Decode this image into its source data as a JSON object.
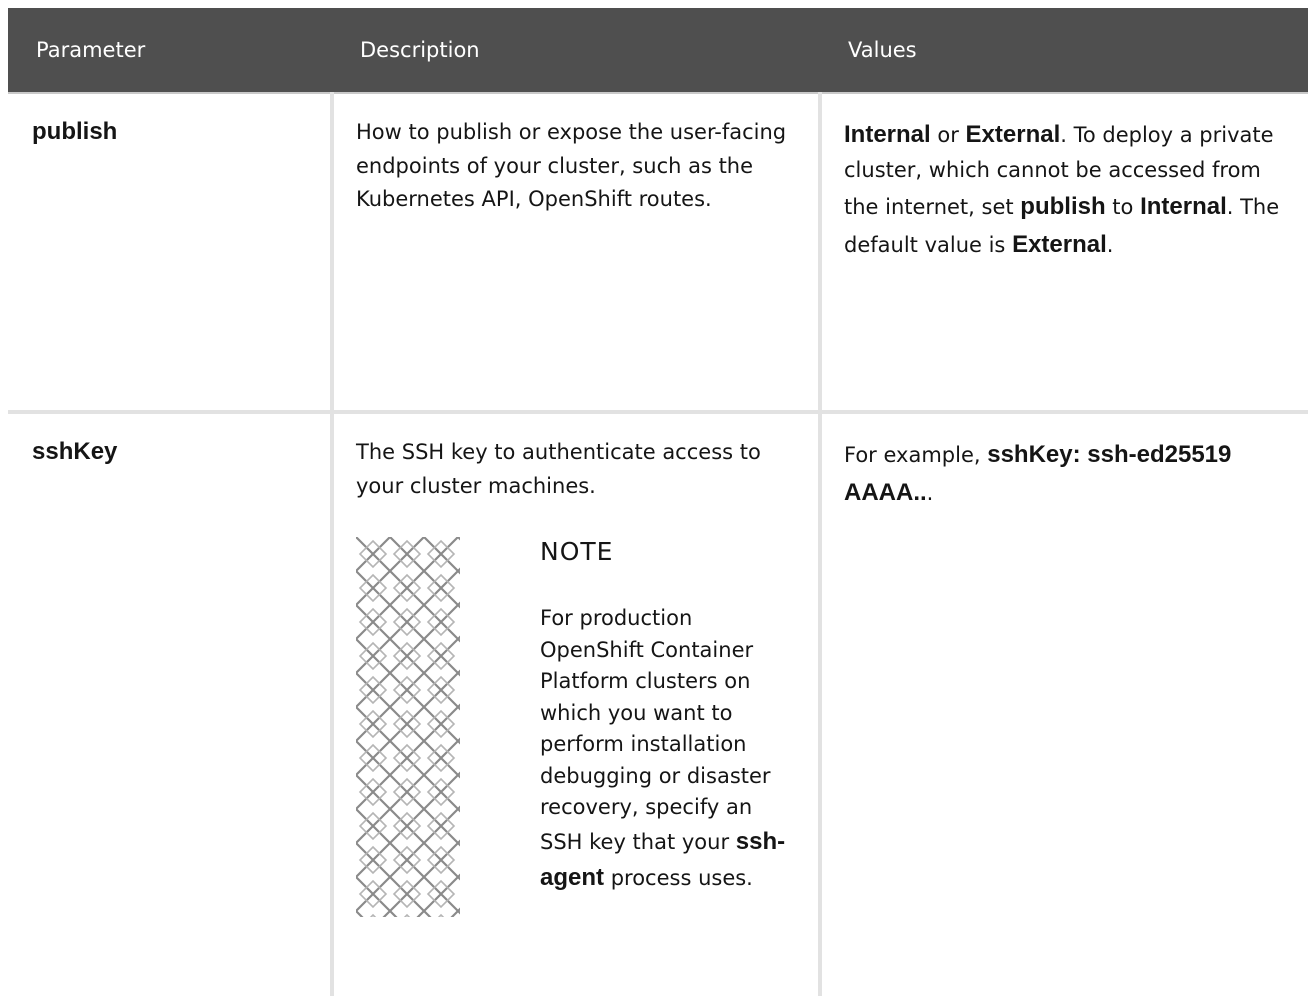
{
  "header": {
    "col_parameter": "Parameter",
    "col_description": "Description",
    "col_values": "Values"
  },
  "rows": [
    {
      "parameter": "publish",
      "description": "How to publish or expose the user-facing endpoints of your cluster, such as the Kubernetes API, OpenShift routes.",
      "values": {
        "v1": "Internal",
        "t1": " or ",
        "v2": "External",
        "t2": ". To deploy a private cluster, which cannot be accessed from the internet, set ",
        "v3": "publish",
        "t3": " to ",
        "v4": "Internal",
        "t4": ". The default value is ",
        "v5": "External",
        "t5": "."
      }
    },
    {
      "parameter": "sshKey",
      "description": "The SSH key to authenticate access to your cluster machines.",
      "note": {
        "title": "NOTE",
        "text_before": "For production OpenShift Container Platform clusters on which you want to perform installation debugging or disaster recovery, specify an SSH key that your ",
        "code": "ssh-agent",
        "text_after": " process uses."
      },
      "values": {
        "t1": "For example, ",
        "v1": "sshKey: ssh-ed25519 AAAA..",
        "t2": "."
      }
    }
  ]
}
